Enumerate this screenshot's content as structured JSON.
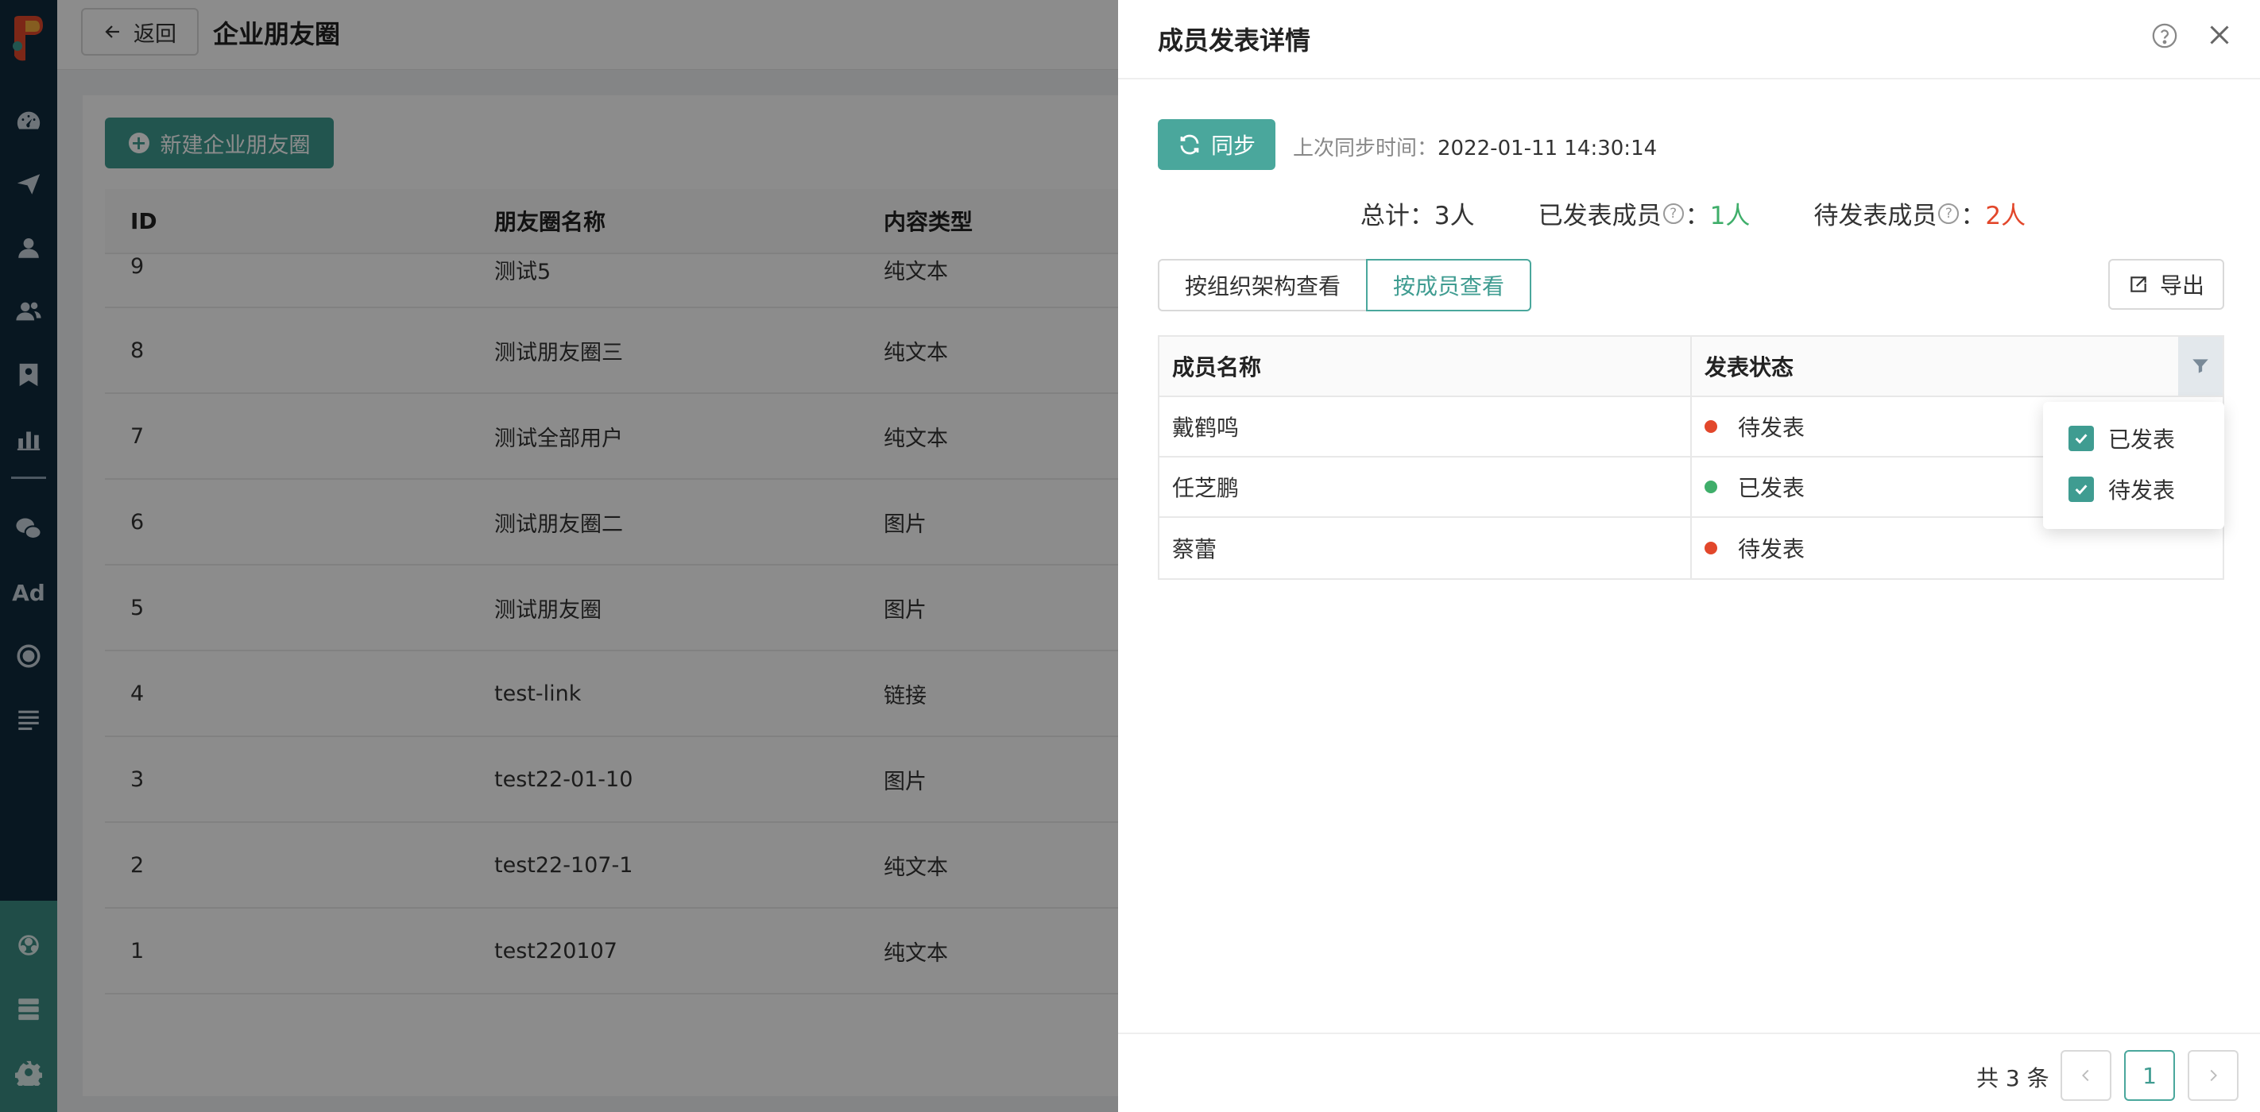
{
  "header": {
    "back_label": "返回",
    "title": "企业朋友圈"
  },
  "main": {
    "new_button_label": "新建企业朋友圈",
    "table": {
      "columns": [
        "ID",
        "朋友圈名称",
        "内容类型"
      ],
      "rows": [
        [
          "9",
          "测试5",
          "纯文本"
        ],
        [
          "8",
          "测试朋友圈三",
          "纯文本"
        ],
        [
          "7",
          "测试全部用户",
          "纯文本"
        ],
        [
          "6",
          "测试朋友圈二",
          "图片"
        ],
        [
          "5",
          "测试朋友圈",
          "图片"
        ],
        [
          "4",
          "test-link",
          "链接"
        ],
        [
          "3",
          "test22-01-10",
          "图片"
        ],
        [
          "2",
          "test22-107-1",
          "纯文本"
        ],
        [
          "1",
          "test220107",
          "纯文本"
        ]
      ]
    }
  },
  "sidebar": {
    "icons": [
      "dashboard-icon",
      "send-icon",
      "user-icon",
      "users-icon",
      "contact-card-icon",
      "bar-chart-icon",
      "wechat-icon",
      "ad-icon",
      "target-icon",
      "list-icon",
      "network-icon",
      "server-icon",
      "gear-icon"
    ],
    "ad_text": "Ad"
  },
  "drawer": {
    "title": "成员发表详情",
    "sync_label": "同步",
    "last_sync_label": "上次同步时间：",
    "last_sync_value": "2022-01-11 14:30:14",
    "summary": {
      "total_label": "总计：",
      "total_value": "3人",
      "published_label": "已发表成员",
      "published_value": "1人",
      "pending_label": "待发表成员",
      "pending_value": "2人",
      "colon": "："
    },
    "view_tabs": {
      "by_org": "按组织架构查看",
      "by_member": "按成员查看"
    },
    "export_label": "导出",
    "table": {
      "col_name": "成员名称",
      "col_status": "发表状态",
      "rows": [
        {
          "name": "戴鹤鸣",
          "status": "待发表",
          "status_color": "#e2472b"
        },
        {
          "name": "任芝鹏",
          "status": "已发表",
          "status_color": "#3fae6a"
        },
        {
          "name": "蔡蕾",
          "status": "待发表",
          "status_color": "#e2472b"
        }
      ]
    },
    "filter": {
      "options": [
        {
          "label": "已发表",
          "checked": true
        },
        {
          "label": "待发表",
          "checked": true
        }
      ]
    },
    "pagination": {
      "total_text": "共 3 条",
      "current_page": "1"
    },
    "colors": {
      "accent": "#3f9c91",
      "published": "#3fae6a",
      "pending": "#e2472b"
    }
  }
}
